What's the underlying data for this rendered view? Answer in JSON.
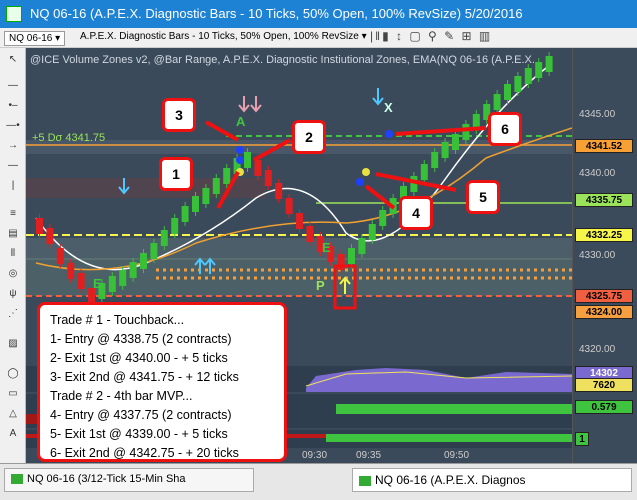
{
  "window": {
    "title": "NQ 06-16 (A.P.E.X. Diagnostic Bars - 10 Ticks, 50% Open, 100% RevSize)  5/20/2016"
  },
  "toolbar": {
    "instrument": "NQ 06-16",
    "description": "A.P.E.X. Diagnostic Bars - 10 Ticks, 50% Open, 100% RevSize"
  },
  "chart": {
    "header_text": "@ICE Volume Zones v2, @Bar Range, A.P.E.X. Diagnostic Instiutional Zones, EMA(NQ 06-16 (A.P.E.X.",
    "range_label": "+5 Dσ 4341.75",
    "price_ticks": [
      "4345.00",
      "4340.00",
      "4330.00",
      "4325.00",
      "4320.00"
    ],
    "price_tags": [
      {
        "text": "4341.52",
        "color": "#f7a035"
      },
      {
        "text": "4335.75",
        "color": "#9ae35a"
      },
      {
        "text": "4332.25",
        "color": "#f5f54a"
      },
      {
        "text": "4325.75",
        "color": "#f06040"
      },
      {
        "text": "4324.00",
        "color": "#f5a040"
      }
    ],
    "indicator_tags": [
      {
        "text": "14302",
        "color": "#7a6ad0"
      },
      {
        "text": "7620",
        "color": "#f0e060"
      },
      {
        "text": "0.579",
        "color": "#3fc43f"
      },
      {
        "text": "1",
        "color": "#3fc43f"
      }
    ],
    "time_labels": [
      "09:30",
      "09:35",
      "09:50"
    ],
    "bar_letters": [
      "E",
      "E",
      "P"
    ],
    "callouts": [
      "1",
      "2",
      "3",
      "4",
      "5",
      "6"
    ]
  },
  "trades": [
    "Trade # 1 - Touchback...",
    "1- Entry @ 4338.75 (2 contracts)",
    "2- Exit 1st @ 4340.00 - + 5 ticks",
    "3- Exit 2nd @ 4341.75 - + 12 ticks",
    "Trade # 2 - 4th bar MVP...",
    "4- Entry @ 4337.75 (2 contracts)",
    "5- Exit 1st @ 4339.00 - + 5 ticks",
    "6- Exit 2nd @ 4342.75 - + 20 ticks"
  ],
  "tabs": [
    {
      "label": "NQ 06-16 (3/12-Tick 15-Min Sha"
    },
    {
      "label": "NQ 06-16 (A.P.E.X. Diagnos"
    }
  ]
}
